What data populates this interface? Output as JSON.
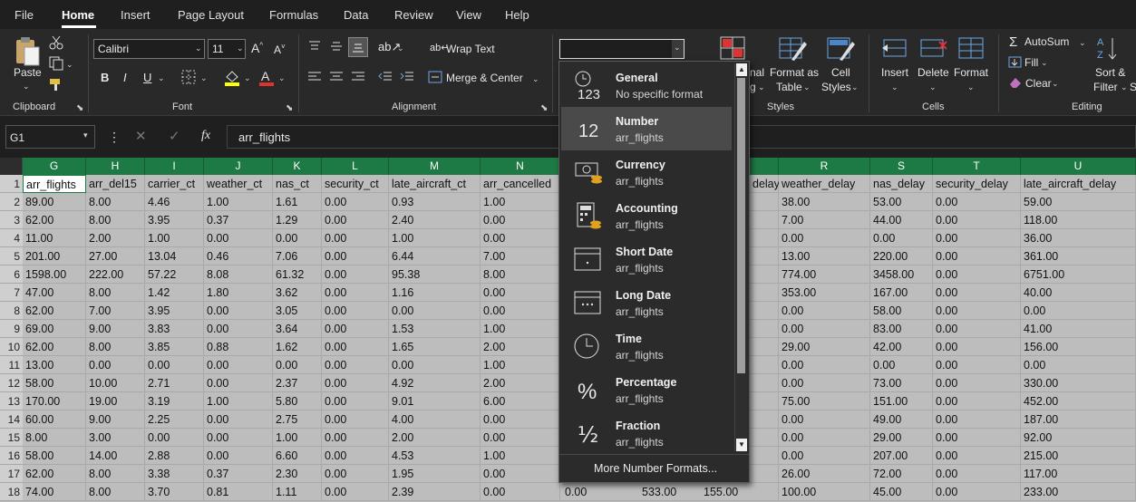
{
  "tabs": [
    "File",
    "Home",
    "Insert",
    "Page Layout",
    "Formulas",
    "Data",
    "Review",
    "View",
    "Help"
  ],
  "ribbon": {
    "paste": "Paste",
    "clipboard": "Clipboard",
    "font_name": "Calibri",
    "font_size": "11",
    "font": "Font",
    "bold": "B",
    "italic": "I",
    "underline": "U",
    "wrap_text": "Wrap Text",
    "merge_center": "Merge & Center",
    "alignment": "Alignment",
    "number_format_value": "",
    "cond_partial": "nal",
    "cond_partial2": "g",
    "format_as_table_1": "Format as",
    "format_as_table_2": "Table",
    "cell_styles_1": "Cell",
    "cell_styles_2": "Styles",
    "styles": "Styles",
    "insert": "Insert",
    "delete": "Delete",
    "format": "Format",
    "cells": "Cells",
    "autosum": "AutoSum",
    "fill": "Fill",
    "clear": "Clear",
    "sort_1": "Sort &",
    "sort_2": "Filter",
    "sort_3": "S",
    "editing": "Editing"
  },
  "formula_bar": {
    "name_box": "G1",
    "fx": "fx",
    "content": "arr_flights"
  },
  "number_menu": {
    "items": [
      {
        "name": "General",
        "sub": "No specific format",
        "icon": "clock-123-icon"
      },
      {
        "name": "Number",
        "sub": "arr_flights",
        "icon": "number-12-icon"
      },
      {
        "name": "Currency",
        "sub": "arr_flights",
        "icon": "currency-icon"
      },
      {
        "name": "Accounting",
        "sub": "arr_flights",
        "icon": "accounting-icon"
      },
      {
        "name": "Short Date",
        "sub": "arr_flights",
        "icon": "calendar-short-icon"
      },
      {
        "name": "Long Date",
        "sub": "arr_flights",
        "icon": "calendar-long-icon"
      },
      {
        "name": "Time",
        "sub": "arr_flights",
        "icon": "clock-icon"
      },
      {
        "name": "Percentage",
        "sub": "arr_flights",
        "icon": "percent-icon"
      },
      {
        "name": "Fraction",
        "sub": "arr_flights",
        "icon": "fraction-icon"
      }
    ],
    "icon_text": {
      "num123": "123",
      "num12": "12",
      "pct": "%",
      "frac": "½"
    },
    "more": "More Number Formats...",
    "selected": "Number"
  },
  "sheet": {
    "left_cols": [
      "G",
      "H",
      "I",
      "J",
      "K",
      "L",
      "M",
      "N"
    ],
    "right_cols": [
      "R",
      "S",
      "T",
      "U"
    ],
    "partial_col_label": "",
    "partial_right_header": "delay",
    "rows": [
      "1",
      "2",
      "3",
      "4",
      "5",
      "6",
      "7",
      "8",
      "9",
      "10",
      "11",
      "12",
      "13",
      "14",
      "15",
      "16",
      "17",
      "18"
    ],
    "left_data": [
      [
        "arr_flights",
        "arr_del15",
        "carrier_ct",
        "weather_ct",
        "nas_ct",
        "security_ct",
        "late_aircraft_ct",
        "arr_cancelled"
      ],
      [
        "89.00",
        "8.00",
        "4.46",
        "1.00",
        "1.61",
        "0.00",
        "0.93",
        "1.00"
      ],
      [
        "62.00",
        "8.00",
        "3.95",
        "0.37",
        "1.29",
        "0.00",
        "2.40",
        "0.00"
      ],
      [
        "11.00",
        "2.00",
        "1.00",
        "0.00",
        "0.00",
        "0.00",
        "1.00",
        "0.00"
      ],
      [
        "201.00",
        "27.00",
        "13.04",
        "0.46",
        "7.06",
        "0.00",
        "6.44",
        "7.00"
      ],
      [
        "1598.00",
        "222.00",
        "57.22",
        "8.08",
        "61.32",
        "0.00",
        "95.38",
        "8.00"
      ],
      [
        "47.00",
        "8.00",
        "1.42",
        "1.80",
        "3.62",
        "0.00",
        "1.16",
        "0.00"
      ],
      [
        "62.00",
        "7.00",
        "3.95",
        "0.00",
        "3.05",
        "0.00",
        "0.00",
        "0.00"
      ],
      [
        "69.00",
        "9.00",
        "3.83",
        "0.00",
        "3.64",
        "0.00",
        "1.53",
        "1.00"
      ],
      [
        "62.00",
        "8.00",
        "3.85",
        "0.88",
        "1.62",
        "0.00",
        "1.65",
        "2.00"
      ],
      [
        "13.00",
        "0.00",
        "0.00",
        "0.00",
        "0.00",
        "0.00",
        "0.00",
        "1.00"
      ],
      [
        "58.00",
        "10.00",
        "2.71",
        "0.00",
        "2.37",
        "0.00",
        "4.92",
        "2.00"
      ],
      [
        "170.00",
        "19.00",
        "3.19",
        "1.00",
        "5.80",
        "0.00",
        "9.01",
        "6.00"
      ],
      [
        "60.00",
        "9.00",
        "2.25",
        "0.00",
        "2.75",
        "0.00",
        "4.00",
        "0.00"
      ],
      [
        "8.00",
        "3.00",
        "0.00",
        "0.00",
        "1.00",
        "0.00",
        "2.00",
        "0.00"
      ],
      [
        "58.00",
        "14.00",
        "2.88",
        "0.00",
        "6.60",
        "0.00",
        "4.53",
        "1.00"
      ],
      [
        "62.00",
        "8.00",
        "3.38",
        "0.37",
        "2.30",
        "0.00",
        "1.95",
        "0.00"
      ],
      [
        "74.00",
        "8.00",
        "3.70",
        "0.81",
        "1.11",
        "0.00",
        "2.39",
        "0.00"
      ]
    ],
    "right_data": [
      [
        "weather_delay",
        "nas_delay",
        "security_delay",
        "late_aircraft_delay"
      ],
      [
        "38.00",
        "53.00",
        "0.00",
        "59.00"
      ],
      [
        "7.00",
        "44.00",
        "0.00",
        "118.00"
      ],
      [
        "0.00",
        "0.00",
        "0.00",
        "36.00"
      ],
      [
        "13.00",
        "220.00",
        "0.00",
        "361.00"
      ],
      [
        "774.00",
        "3458.00",
        "0.00",
        "6751.00"
      ],
      [
        "353.00",
        "167.00",
        "0.00",
        "40.00"
      ],
      [
        "0.00",
        "58.00",
        "0.00",
        "0.00"
      ],
      [
        "0.00",
        "83.00",
        "0.00",
        "41.00"
      ],
      [
        "29.00",
        "42.00",
        "0.00",
        "156.00"
      ],
      [
        "0.00",
        "0.00",
        "0.00",
        "0.00"
      ],
      [
        "0.00",
        "73.00",
        "0.00",
        "330.00"
      ],
      [
        "75.00",
        "151.00",
        "0.00",
        "452.00"
      ],
      [
        "0.00",
        "49.00",
        "0.00",
        "187.00"
      ],
      [
        "0.00",
        "29.00",
        "0.00",
        "92.00"
      ],
      [
        "0.00",
        "207.00",
        "0.00",
        "215.00"
      ],
      [
        "26.00",
        "72.00",
        "0.00",
        "117.00"
      ],
      [
        "100.00",
        "45.00",
        "0.00",
        "233.00"
      ]
    ],
    "last_row_hidden_cols": [
      "0.00",
      "533.00",
      "155.00"
    ]
  },
  "colors": {
    "accent": "#1e7a45",
    "menu_bg": "#2b2b2b",
    "selected_item": "#4a4a4a"
  }
}
